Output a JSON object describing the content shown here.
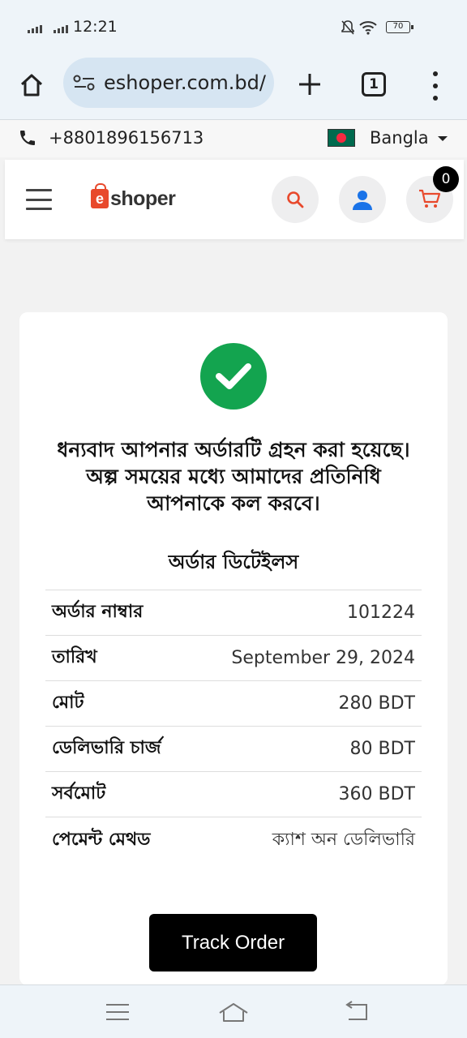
{
  "status_bar": {
    "time": "12:21",
    "battery": "70",
    "icons": [
      "signal-icon",
      "signal-icon",
      "mute-icon",
      "wifi-icon",
      "battery-icon"
    ]
  },
  "browser": {
    "url": "eshoper.com.bd/c",
    "tab_count": "1",
    "icons": [
      "home-icon",
      "site-settings-icon",
      "plus-icon",
      "tabs-icon",
      "more-vert-icon"
    ]
  },
  "contact": {
    "phone": "+8801896156713",
    "language": "Bangla"
  },
  "header": {
    "logo_letter": "e",
    "logo_text": "shoper",
    "cart_count": "0"
  },
  "order": {
    "thanks_message": "ধন্যবাদ আপনার অর্ডারটি গ্রহন করা হয়েছে। অল্প সময়ের মধ্যে আমাদের প্রতিনিধি আপনাকে কল করবে।",
    "details_title": "অর্ডার ডিটেইলস",
    "rows": [
      {
        "label": "অর্ডার নাম্বার",
        "value": "101224"
      },
      {
        "label": "তারিখ",
        "value": "September 29, 2024"
      },
      {
        "label": "মোট",
        "value": "280 BDT"
      },
      {
        "label": "ডেলিভারি চার্জ",
        "value": "80 BDT"
      },
      {
        "label": "সর্বমোট",
        "value": "360 BDT"
      },
      {
        "label": "পেমেন্ট মেথড",
        "value": "ক্যাশ অন ডেলিভারি"
      }
    ],
    "track_label": "Track Order"
  },
  "colors": {
    "accent_red": "#e8492c",
    "success_green": "#13a44f",
    "user_blue": "#1a73e8"
  }
}
